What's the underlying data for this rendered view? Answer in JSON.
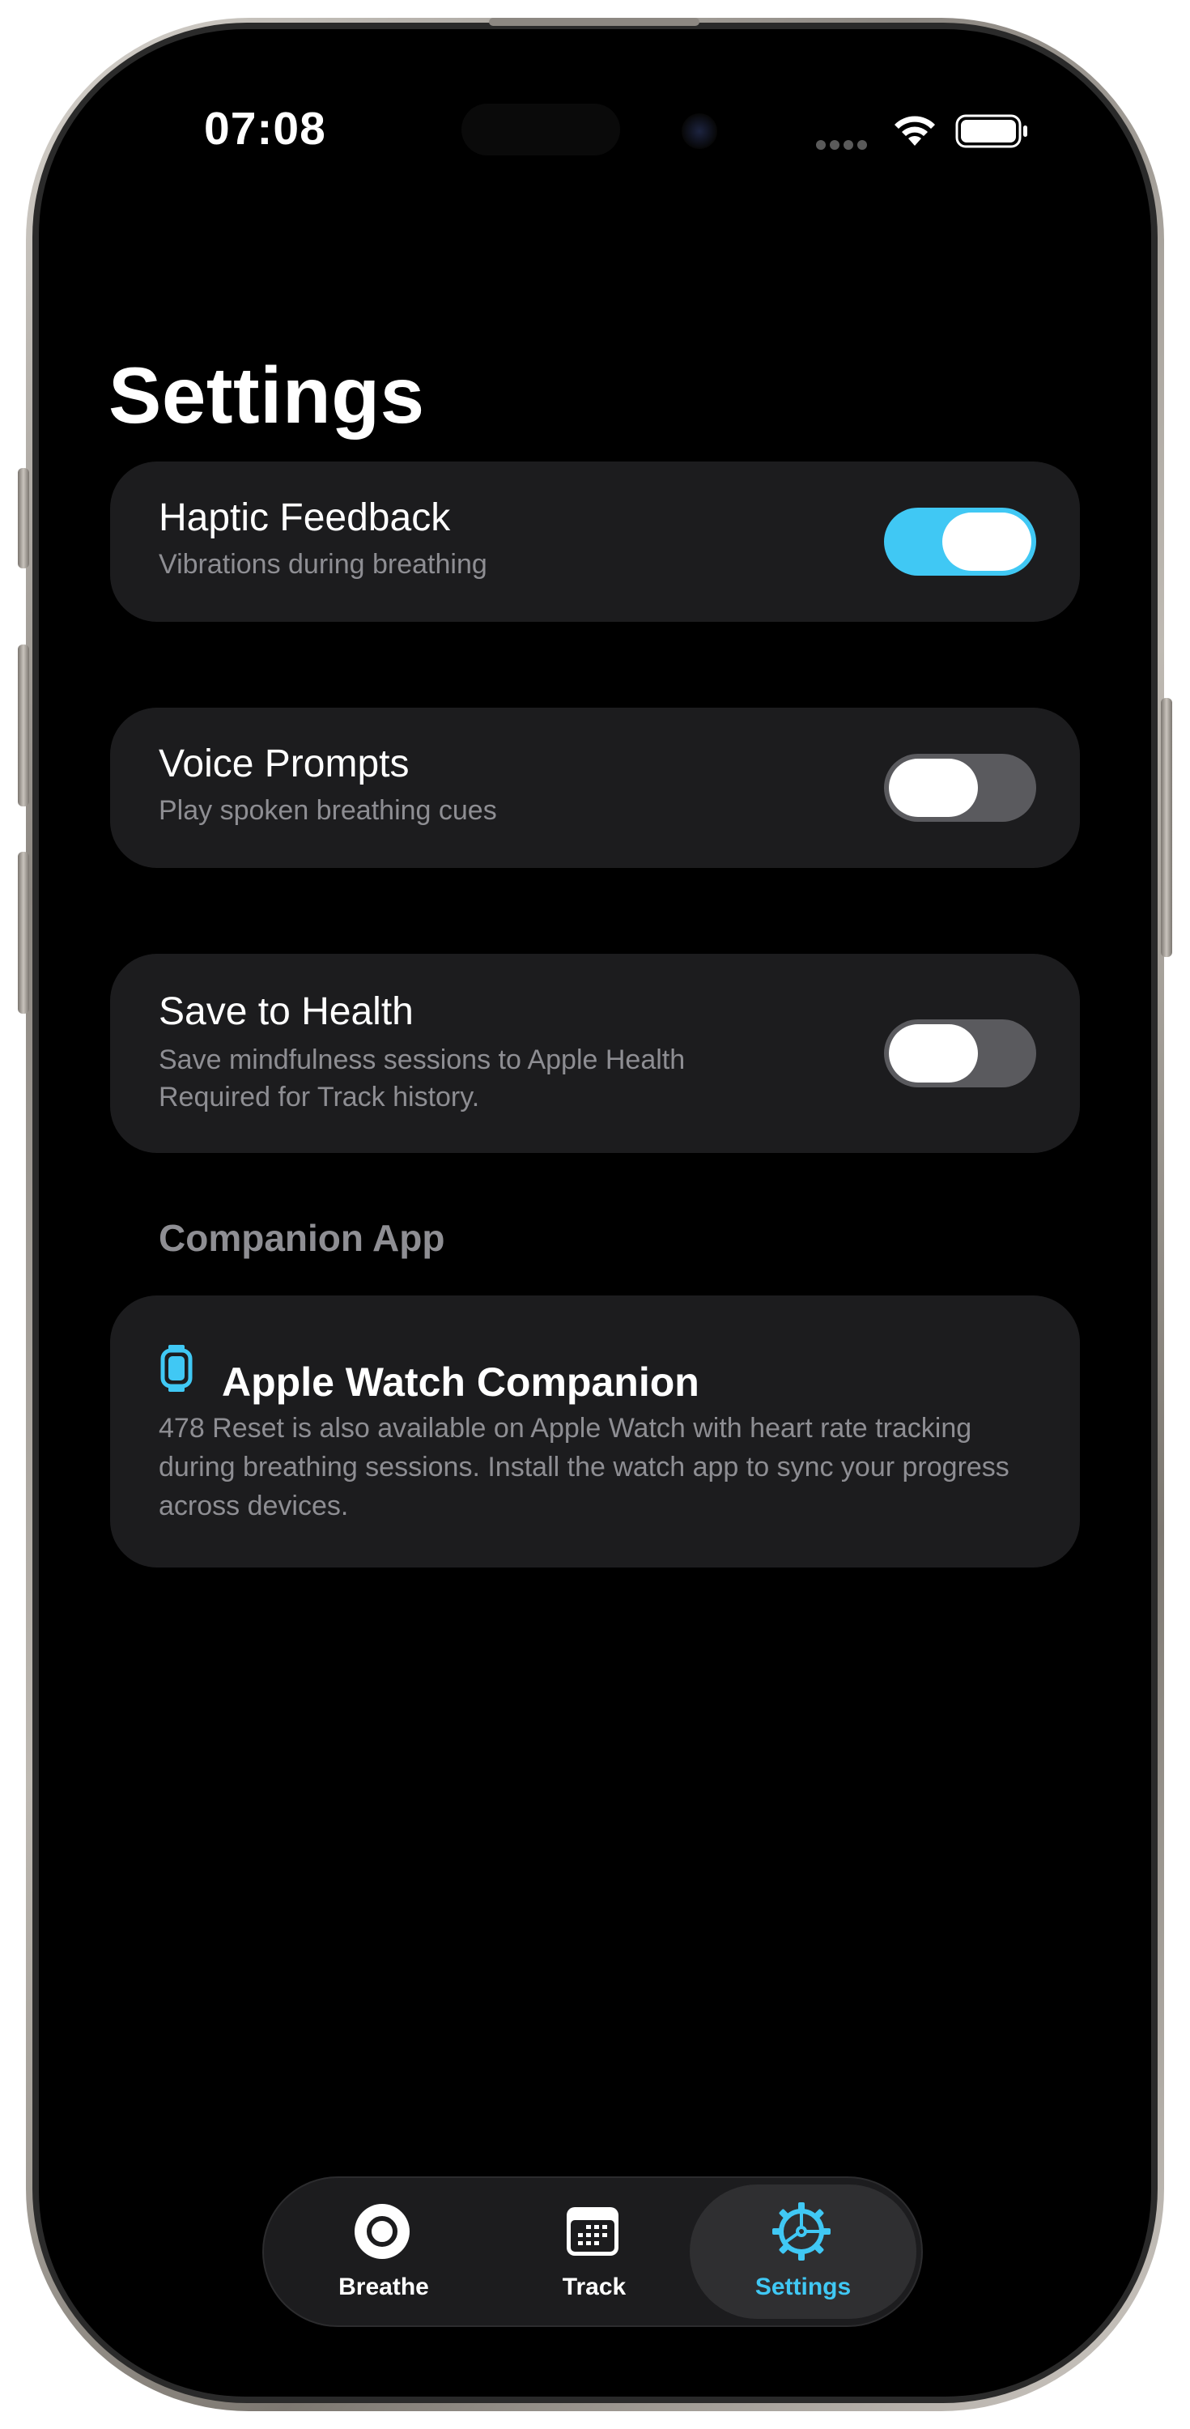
{
  "status_bar": {
    "time": "07:08"
  },
  "page": {
    "title": "Settings"
  },
  "settings": {
    "haptic": {
      "title": "Haptic Feedback",
      "subtitle": "Vibrations during breathing",
      "enabled": true
    },
    "voice": {
      "title": "Voice Prompts",
      "subtitle": "Play spoken breathing cues",
      "enabled": false
    },
    "health": {
      "title": "Save to Health",
      "subtitle": "Save mindfulness sessions to Apple Health",
      "note": "Required for Track history.",
      "enabled": false
    }
  },
  "companion": {
    "section_header": "Companion App",
    "title": "Apple Watch Companion",
    "body": "478 Reset is also available on Apple Watch with heart rate tracking during breathing sessions. Install the watch app to sync your progress across devices.",
    "icon": "applewatch-icon"
  },
  "tabbar": {
    "tabs": [
      {
        "label": "Breathe",
        "icon": "breathe-circle-icon",
        "active": false
      },
      {
        "label": "Track",
        "icon": "calendar-icon",
        "active": false
      },
      {
        "label": "Settings",
        "icon": "gear-icon",
        "active": true
      }
    ]
  },
  "colors": {
    "accent": "#40c8f4",
    "background": "#000000",
    "card": "#1c1c1e",
    "secondary_text": "#8e8e93",
    "toggle_off": "#5a5a5e"
  }
}
